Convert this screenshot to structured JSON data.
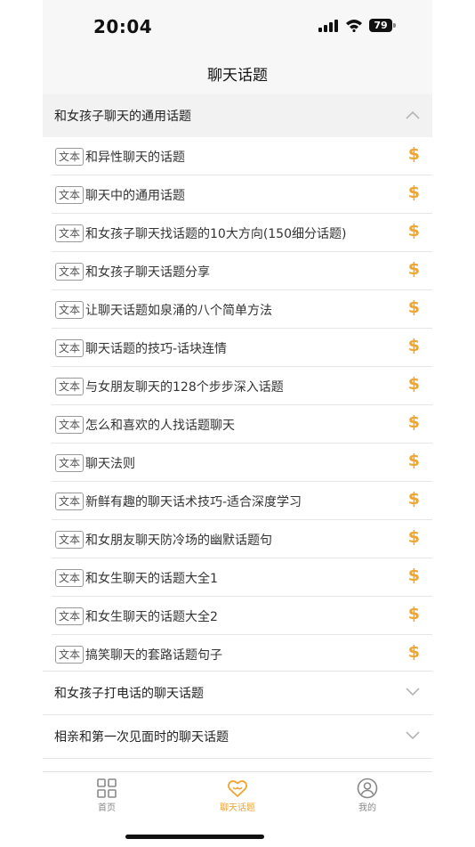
{
  "status": {
    "time": "20:04",
    "battery": "79"
  },
  "nav": {
    "title": "聊天话题"
  },
  "sections": {
    "expanded": {
      "title": "和女孩子聊天的通用话题"
    },
    "collapsed1": {
      "title": "和女孩子打电话的聊天话题"
    },
    "collapsed2": {
      "title": "相亲和第一次见面时的聊天话题"
    }
  },
  "tag_label": "文本",
  "price_symbol": "$",
  "items": [
    {
      "title": "和异性聊天的话题"
    },
    {
      "title": "聊天中的通用话题"
    },
    {
      "title": "和女孩子聊天找话题的10大方向(150细分话题)"
    },
    {
      "title": "和女孩子聊天话题分享"
    },
    {
      "title": "让聊天话题如泉涌的八个简单方法"
    },
    {
      "title": "聊天话题的技巧-话块连情"
    },
    {
      "title": "与女朋友聊天的128个步步深入话题"
    },
    {
      "title": "怎么和喜欢的人找话题聊天"
    },
    {
      "title": "聊天法则"
    },
    {
      "title": "新鲜有趣的聊天话术技巧-适合深度学习"
    },
    {
      "title": "和女朋友聊天防冷场的幽默话题句"
    },
    {
      "title": "和女生聊天的话题大全1"
    },
    {
      "title": "和女生聊天的话题大全2"
    },
    {
      "title": "搞笑聊天的套路话题句子"
    }
  ],
  "tabs": [
    {
      "label": "首页",
      "icon": "grid-icon"
    },
    {
      "label": "聊天话题",
      "icon": "heart-chat-icon"
    },
    {
      "label": "我的",
      "icon": "user-icon"
    }
  ],
  "colors": {
    "accent": "#f0a530"
  }
}
